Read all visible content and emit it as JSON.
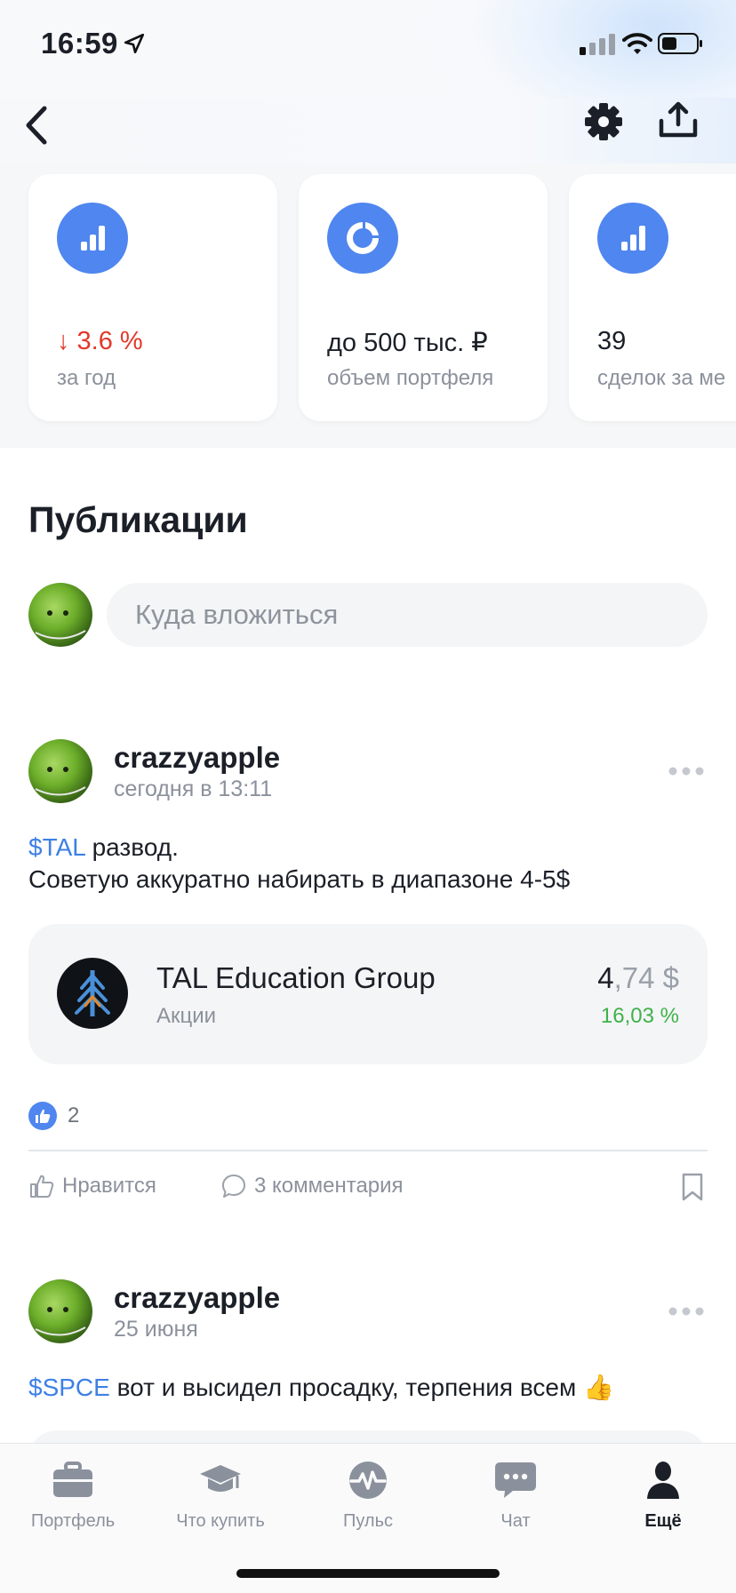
{
  "status_bar": {
    "time": "16:59"
  },
  "stats": [
    {
      "value": "↓ 3.6 %",
      "label": "за год"
    },
    {
      "value": "до 500 тыс. ₽",
      "label": "объем портфеля"
    },
    {
      "value": "39",
      "label": "сделок за ме"
    }
  ],
  "publications": {
    "title": "Публикации",
    "search_placeholder": "Куда вложиться"
  },
  "posts": [
    {
      "author": "crazzyapple",
      "date": "сегодня в 13:11",
      "ticker": "$TAL",
      "text_rest": " развод.",
      "text_line2": "Советую аккуратно набирать в диапазоне 4-5$",
      "instrument": {
        "name": "TAL Education Group",
        "type": "Акции",
        "price_int": "4",
        "price_dec": ",74 $",
        "change": "16,03 %"
      },
      "likes": "2",
      "like_label": "Нравится",
      "comments_label": "3 комментария"
    },
    {
      "author": "crazzyapple",
      "date": "25 июня",
      "ticker": "$SPCE",
      "text_rest": " вот и высидел просадку, терпения всем 👍"
    }
  ],
  "tab_bar": {
    "tabs": [
      {
        "label": "Портфель",
        "icon": "briefcase-icon"
      },
      {
        "label": "Что купить",
        "icon": "graduation-cap-icon"
      },
      {
        "label": "Пульс",
        "icon": "pulse-icon"
      },
      {
        "label": "Чат",
        "icon": "chat-icon"
      },
      {
        "label": "Ещё",
        "icon": "profile-icon"
      }
    ],
    "active_index": 4
  },
  "colors": {
    "accent_blue": "#4f86ef",
    "ticker_blue": "#3d80e6",
    "negative_red": "#e2382b",
    "positive_green": "#3fb24a"
  }
}
